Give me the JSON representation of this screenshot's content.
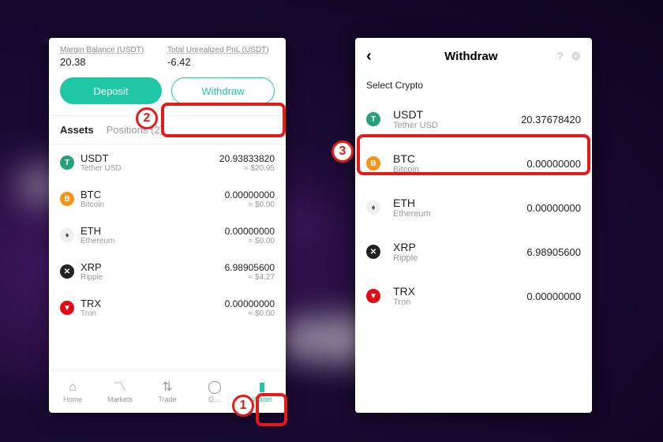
{
  "colors": {
    "accent": "#1fc7a6",
    "callout": "#e51b1b"
  },
  "left": {
    "margin_label": "Margin Balance (USDT)",
    "margin_value": "20.38",
    "pnl_label": "Total Unrealized PnL (USDT)",
    "pnl_value": "-6.42",
    "deposit_label": "Deposit",
    "withdraw_label": "Withdraw",
    "tabs": {
      "assets": "Assets",
      "positions": "Positions (2)"
    },
    "assets": [
      {
        "icon": "usdt",
        "sym": "USDT",
        "full": "Tether USD",
        "amt": "20.93833820",
        "usd": "≈ $20.95"
      },
      {
        "icon": "btc",
        "sym": "BTC",
        "full": "Bitcoin",
        "amt": "0.00000000",
        "usd": "≈ $0.00"
      },
      {
        "icon": "eth",
        "sym": "ETH",
        "full": "Ethereum",
        "amt": "0.00000000",
        "usd": "≈ $0.00"
      },
      {
        "icon": "xrp",
        "sym": "XRP",
        "full": "Ripple",
        "amt": "6.98905600",
        "usd": "≈ $4.27"
      },
      {
        "icon": "trx",
        "sym": "TRX",
        "full": "Tron",
        "amt": "0.00000000",
        "usd": "≈ $0.00"
      }
    ],
    "nav": [
      {
        "icon": "⌂",
        "label": "Home"
      },
      {
        "icon": "〽",
        "label": "Markets"
      },
      {
        "icon": "⇅",
        "label": "Trade"
      },
      {
        "icon": "◯",
        "label": "O…"
      },
      {
        "icon": "▮",
        "label": "Wallet"
      }
    ]
  },
  "right": {
    "title": "Withdraw",
    "subtitle": "Select Crypto",
    "assets": [
      {
        "icon": "usdt",
        "sym": "USDT",
        "full": "Tether USD",
        "amt": "20.37678420"
      },
      {
        "icon": "btc",
        "sym": "BTC",
        "full": "Bitcoin",
        "amt": "0.00000000"
      },
      {
        "icon": "eth",
        "sym": "ETH",
        "full": "Ethereum",
        "amt": "0.00000000"
      },
      {
        "icon": "xrp",
        "sym": "XRP",
        "full": "Ripple",
        "amt": "6.98905600"
      },
      {
        "icon": "trx",
        "sym": "TRX",
        "full": "Tron",
        "amt": "0.00000000"
      }
    ]
  },
  "callouts": {
    "one": "1",
    "two": "2",
    "three": "3"
  },
  "icon_glyph": {
    "usdt": "T",
    "btc": "B",
    "eth": "♦",
    "xrp": "✕",
    "trx": "▼"
  }
}
